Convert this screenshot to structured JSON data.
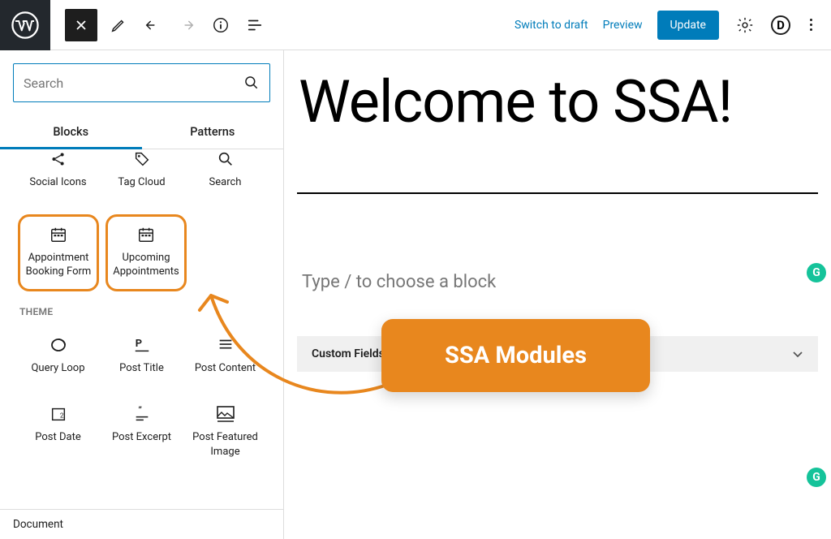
{
  "topbar": {
    "switch_draft": "Switch to draft",
    "preview": "Preview",
    "update": "Update",
    "d_label": "D"
  },
  "sidebar": {
    "search_placeholder": "Search",
    "tab_blocks": "Blocks",
    "tab_patterns": "Patterns",
    "row1": [
      "Social Icons",
      "Tag Cloud",
      "Search"
    ],
    "ssa": [
      "Appointment Booking Form",
      "Upcoming Appointments"
    ],
    "theme_label": "THEME",
    "themeRow1": [
      "Query Loop",
      "Post Title",
      "Post Content"
    ],
    "themeRow2": [
      "Post Date",
      "Post Excerpt",
      "Post Featured Image"
    ],
    "document_tab": "Document"
  },
  "content": {
    "title": "Welcome to SSA!",
    "placeholder": "Type / to choose a block",
    "custom_fields": "Custom Fields"
  },
  "annotation": {
    "callout": "SSA Modules",
    "g": "G"
  }
}
